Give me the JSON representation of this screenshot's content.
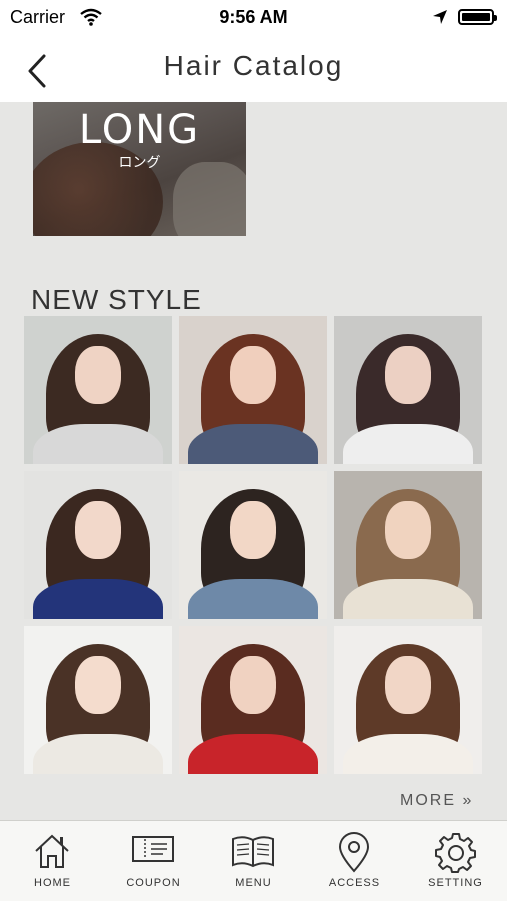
{
  "status_bar": {
    "carrier": "Carrier",
    "time": "9:56 AM"
  },
  "nav": {
    "title": "Hair Catalog"
  },
  "category": {
    "title": "LONG",
    "subtitle": "ロング"
  },
  "section": {
    "title": "NEW STYLE",
    "more": "MORE »"
  },
  "styles": [
    {
      "bg": "#cfd2cf",
      "hair": "#3c2a22",
      "face": "#efd3c4",
      "body": "#d8d8d8"
    },
    {
      "bg": "#d9d2cc",
      "hair": "#6a3322",
      "face": "#f0cfbd",
      "body": "#4c5a78"
    },
    {
      "bg": "#c9c9c7",
      "hair": "#3a2a2a",
      "face": "#ecd0c3",
      "body": "#eeeeee"
    },
    {
      "bg": "#e3e3e1",
      "hair": "#3b2820",
      "face": "#f2d8ca",
      "body": "#23347a"
    },
    {
      "bg": "#eae8e4",
      "hair": "#2d2420",
      "face": "#f2d7c6",
      "body": "#6e89a8"
    },
    {
      "bg": "#b8b4ae",
      "hair": "#8a6a4e",
      "face": "#f0d3bf",
      "body": "#e8e1d4"
    },
    {
      "bg": "#f2f2f0",
      "hair": "#4a3226",
      "face": "#f4dccd",
      "body": "#ece9e3"
    },
    {
      "bg": "#ebe6e2",
      "hair": "#5a2c20",
      "face": "#f0d2c1",
      "body": "#c8242a"
    },
    {
      "bg": "#f0eeec",
      "hair": "#5e3a28",
      "face": "#f1d6c6",
      "body": "#f3efe9"
    }
  ],
  "tabs": [
    {
      "label": "HOME",
      "icon": "home-icon"
    },
    {
      "label": "COUPON",
      "icon": "coupon-icon"
    },
    {
      "label": "MENU",
      "icon": "menu-book-icon"
    },
    {
      "label": "ACCESS",
      "icon": "location-pin-icon"
    },
    {
      "label": "SETTING",
      "icon": "gear-icon"
    }
  ]
}
